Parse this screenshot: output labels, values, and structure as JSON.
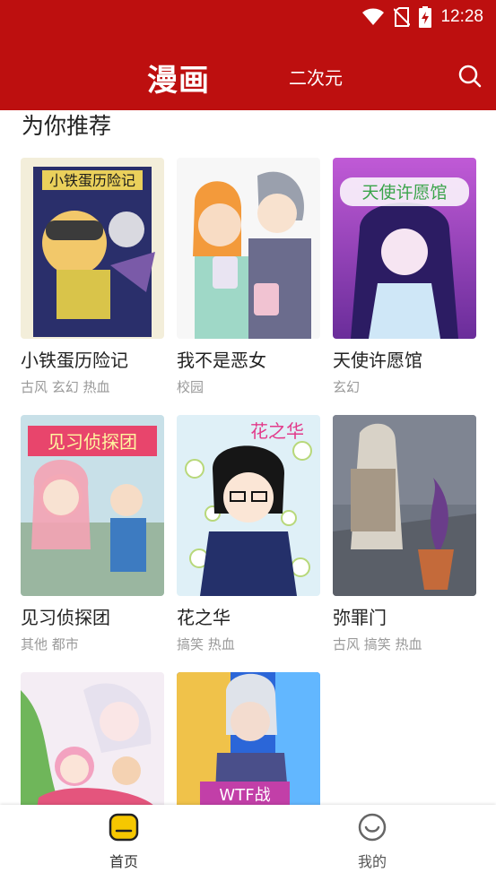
{
  "status_bar": {
    "time": "12:28",
    "icons": [
      "wifi-icon",
      "no-sim-icon",
      "battery-charging-icon"
    ]
  },
  "header": {
    "title": "漫画",
    "tab_secondary": "二次元",
    "search_icon": "search-icon"
  },
  "section": {
    "title": "为你推荐"
  },
  "comics": [
    {
      "title": "小铁蛋历险记",
      "tags": "古风 玄幻 热血",
      "cover_text": "小铁蛋历险记"
    },
    {
      "title": "我不是恶女",
      "tags": "校园",
      "cover_text": ""
    },
    {
      "title": "天使许愿馆",
      "tags": "玄幻",
      "cover_text": "天使许愿馆"
    },
    {
      "title": "见习侦探团",
      "tags": "其他 都市",
      "cover_text": "见习侦探团"
    },
    {
      "title": "花之华",
      "tags": "搞笑 热血",
      "cover_text": "花之华"
    },
    {
      "title": "弥罪门",
      "tags": "古风 搞笑 热血",
      "cover_text": ""
    },
    {
      "title": "",
      "tags": "",
      "cover_text": ""
    },
    {
      "title": "",
      "tags": "",
      "cover_text": "WTF战"
    }
  ],
  "bottom_nav": {
    "home_label": "首页",
    "me_label": "我的",
    "home_icon": "home-face-icon",
    "me_icon": "smiley-icon"
  },
  "colors": {
    "header": "#bd0f0f",
    "tag_text": "#999999",
    "nav_active": "#f6c700"
  }
}
